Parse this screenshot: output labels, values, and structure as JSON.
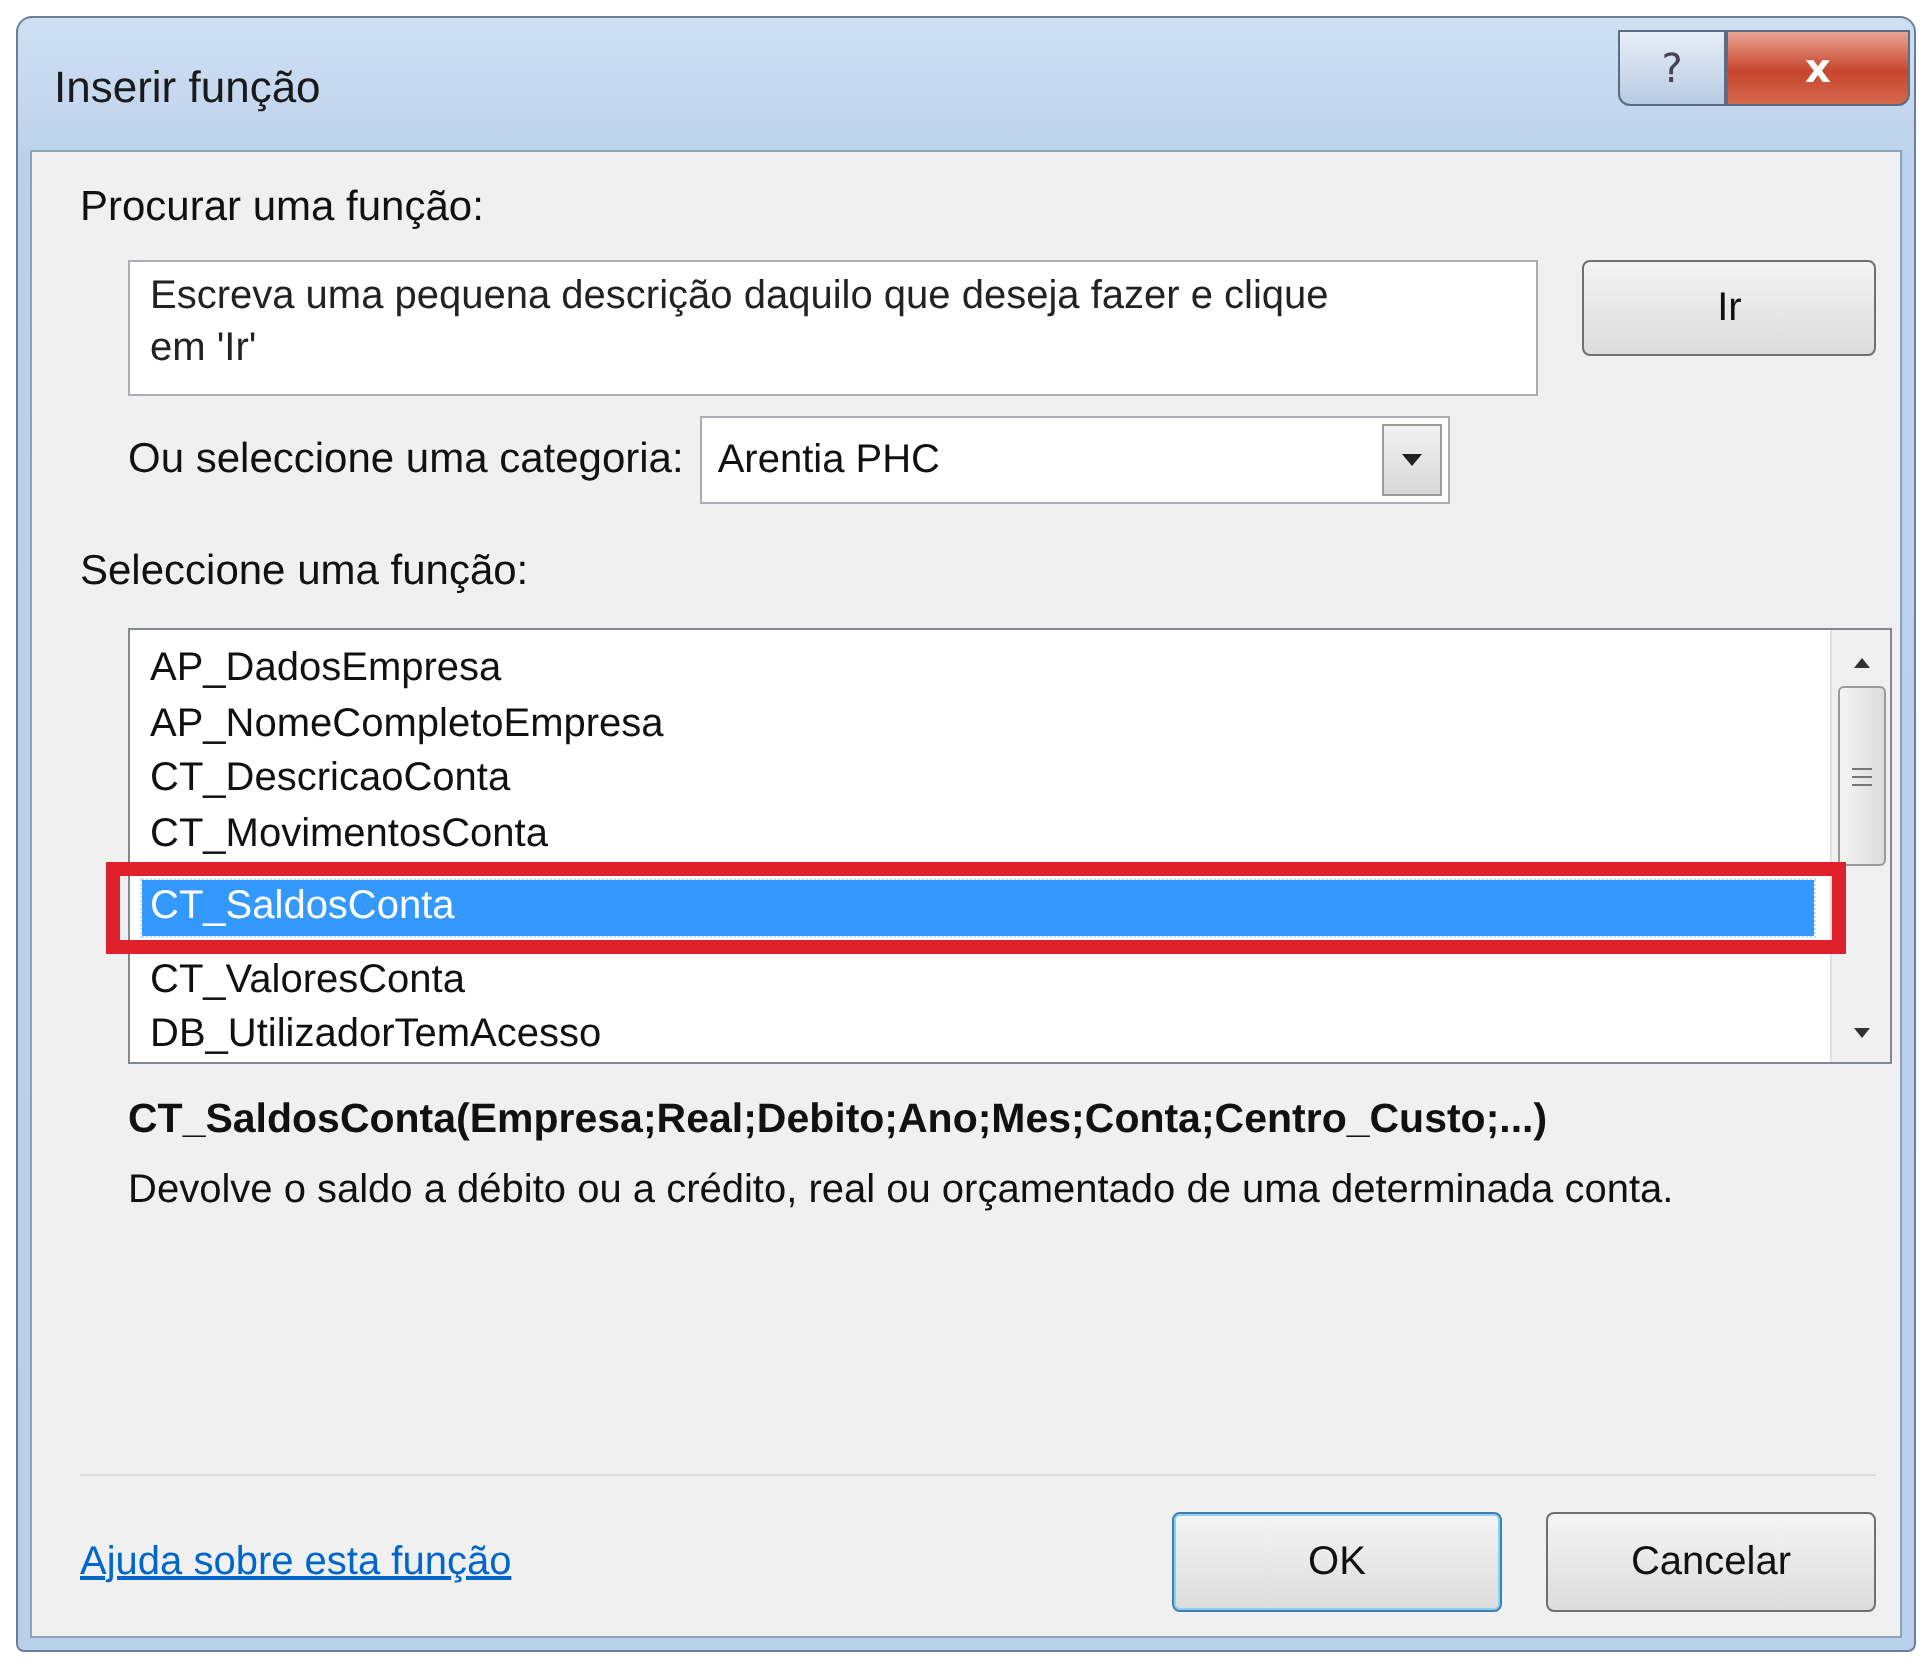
{
  "window": {
    "title": "Inserir função",
    "help_button": "?",
    "close_button": "x"
  },
  "search": {
    "label": "Procurar uma função:",
    "placeholder": "Escreva uma pequena descrição daquilo que deseja fazer e clique em 'Ir'",
    "button": "Ir"
  },
  "category": {
    "label": "Ou seleccione uma categoria:",
    "value": "Arentia PHC"
  },
  "function_list": {
    "label": "Seleccione uma função:",
    "items": [
      {
        "text": "AP_DadosEmpresa",
        "selected": false,
        "highlighted": false
      },
      {
        "text": "AP_NomeCompletoEmpresa",
        "selected": false,
        "highlighted": false
      },
      {
        "text": "CT_DescricaoConta",
        "selected": false,
        "highlighted": false
      },
      {
        "text": "CT_MovimentosConta",
        "selected": false,
        "highlighted": false
      },
      {
        "text": "CT_SaldosConta",
        "selected": true,
        "highlighted": true
      },
      {
        "text": "CT_ValoresConta",
        "selected": false,
        "highlighted": false
      },
      {
        "text": "DB_UtilizadorTemAcesso",
        "selected": false,
        "highlighted": false
      }
    ]
  },
  "signature": "CT_SaldosConta(Empresa;Real;Debito;Ano;Mes;Conta;Centro_Custo;...)",
  "description": "Devolve o saldo a débito ou a crédito, real ou orçamentado de uma determinada conta.",
  "help_link": "Ajuda sobre esta função",
  "buttons": [
    {
      "label": "OK",
      "default": true
    },
    {
      "label": "Cancelar",
      "default": false
    }
  ]
}
